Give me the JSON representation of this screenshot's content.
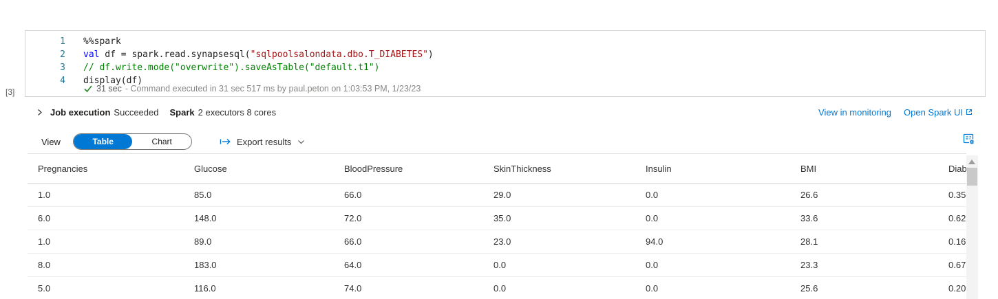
{
  "cell": {
    "execution_count_label": "[3]",
    "code_lines": [
      {
        "number": "1",
        "tokens": [
          {
            "type": "plain",
            "text": "%%spark"
          }
        ]
      },
      {
        "number": "2",
        "tokens": [
          {
            "type": "keyword",
            "text": "val"
          },
          {
            "type": "plain",
            "text": " df = spark.read.synapsesql("
          },
          {
            "type": "string",
            "text": "\"sqlpoolsalondata.dbo.T_DIABETES\""
          },
          {
            "type": "plain",
            "text": ")"
          }
        ]
      },
      {
        "number": "3",
        "tokens": [
          {
            "type": "comment",
            "text": "// df.write.mode(\"overwrite\").saveAsTable(\"default.t1\")"
          }
        ]
      },
      {
        "number": "4",
        "tokens": [
          {
            "type": "plain",
            "text": "display(df)"
          }
        ]
      }
    ],
    "status": {
      "duration": "31 sec",
      "detail": "- Command executed in 31 sec 517 ms by paul.peton on 1:03:53 PM, 1/23/23"
    }
  },
  "job": {
    "label": "Job execution",
    "status": "Succeeded",
    "spark_label": "Spark",
    "spark_detail": "2 executors 8 cores",
    "monitor_link": "View in monitoring",
    "spark_ui_link": "Open Spark UI"
  },
  "results": {
    "view_label": "View",
    "view_options": [
      "Table",
      "Chart"
    ],
    "selected_view": "Table",
    "export_label": "Export results",
    "table": {
      "columns": [
        "Pregnancies",
        "Glucose",
        "BloodPressure",
        "SkinThickness",
        "Insulin",
        "BMI",
        "Diab"
      ],
      "rows": [
        [
          "1.0",
          "85.0",
          "66.0",
          "29.0",
          "0.0",
          "26.6",
          "0.35"
        ],
        [
          "6.0",
          "148.0",
          "72.0",
          "35.0",
          "0.0",
          "33.6",
          "0.62"
        ],
        [
          "1.0",
          "89.0",
          "66.0",
          "23.0",
          "94.0",
          "28.1",
          "0.16"
        ],
        [
          "8.0",
          "183.0",
          "64.0",
          "0.0",
          "0.0",
          "23.3",
          "0.67"
        ],
        [
          "5.0",
          "116.0",
          "74.0",
          "0.0",
          "0.0",
          "25.6",
          "0.20"
        ]
      ]
    }
  },
  "colors": {
    "accent": "#0078d4",
    "success_check": "#218721",
    "code_keyword": "#0000ff",
    "code_string": "#a31515",
    "code_comment": "#008000",
    "line_number": "#237893"
  }
}
